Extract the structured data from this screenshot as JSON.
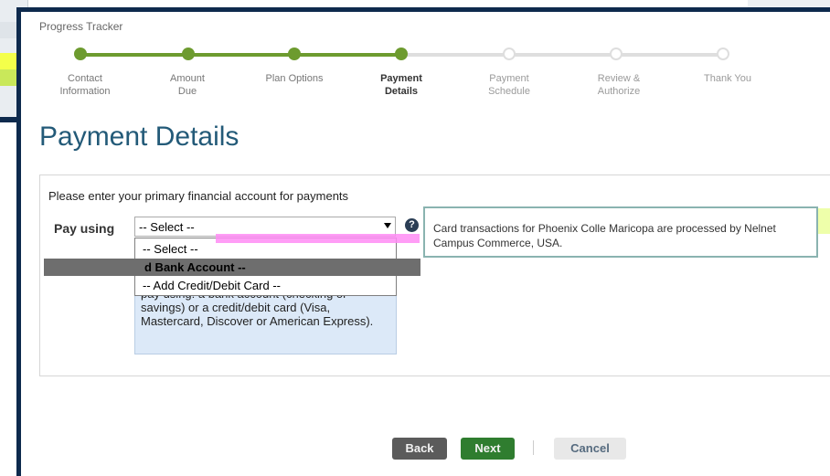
{
  "tracker": {
    "title": "Progress Tracker",
    "steps": [
      {
        "line1": "Contact",
        "line2": "Information",
        "state": "done"
      },
      {
        "line1": "Amount",
        "line2": "Due",
        "state": "done"
      },
      {
        "line1": "Plan Options",
        "line2": "",
        "state": "done"
      },
      {
        "line1": "Payment",
        "line2": "Details",
        "state": "current"
      },
      {
        "line1": "Payment",
        "line2": "Schedule",
        "state": "todo"
      },
      {
        "line1": "Review &",
        "line2": "Authorize",
        "state": "todo"
      },
      {
        "line1": "Thank You",
        "line2": "",
        "state": "todo"
      }
    ]
  },
  "page": {
    "title": "Payment Details",
    "instruction": "Please enter your primary financial account for payments",
    "pay_label": "Pay using"
  },
  "select": {
    "value": "-- Select --",
    "options": [
      "-- Select --",
      "d Bank Account --",
      "-- Add Credit/Debit Card --"
    ]
  },
  "help": {
    "icon_glyph": "?",
    "text_cut": "pay using: a bank account (checking or",
    "text": "savings) or a credit/debit card (Visa, Mastercard, Discover or American Express)."
  },
  "info": {
    "text": "Card transactions for Phoenix Colle Maricopa are processed by Nelnet Campus Commerce, USA."
  },
  "buttons": {
    "back": "Back",
    "next": "Next",
    "cancel": "Cancel"
  },
  "colors": {
    "done": "#6d9b2f",
    "todo": "#dedede",
    "title": "#235a78",
    "frame": "#0e2a4d"
  }
}
